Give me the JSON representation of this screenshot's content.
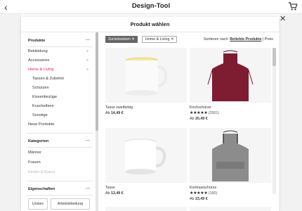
{
  "app": {
    "title": "Design-Tool"
  },
  "modal": {
    "title": "Produkt wählen",
    "close_glyph": "✕"
  },
  "sidebar": {
    "products_heading": "Produkte",
    "products_items": [
      {
        "label": "Bekleidung",
        "chevron": "⌄"
      },
      {
        "label": "Accessoires",
        "chevron": "⌄"
      },
      {
        "label": "Home & Living",
        "chevron": "⌃",
        "active": true
      },
      {
        "label": "Tassen & Zubehör"
      },
      {
        "label": "Schürzen"
      },
      {
        "label": "Kissenbezüge"
      },
      {
        "label": "Kuscheltiere"
      },
      {
        "label": "Sonstige"
      },
      {
        "label": "Neue Produkte"
      }
    ],
    "categories_heading": "Kategorien",
    "categories_items": [
      {
        "label": "Männer"
      },
      {
        "label": "Frauen"
      },
      {
        "label": "Kinder & Babys",
        "disabled": true
      }
    ],
    "properties_heading": "Eigenschaften",
    "toggle_glyph": "—",
    "property_buttons": [
      "Unisex",
      "Arbeitskleidung"
    ]
  },
  "filters": {
    "reset_label": "Zurücksetzen",
    "active_chip": "Home & Living",
    "remove_glyph": "✕",
    "sort_prefix": "Sortieren nach:",
    "sort_value": "Beliebte Produkte",
    "sort_suffix": "| Preis"
  },
  "products": [
    {
      "title": "Tasse zweifarbig",
      "price_prefix": "Ab",
      "price": "14,49 €"
    },
    {
      "title": "Kochschürze",
      "stars": "★★★★★",
      "reviews": "(2501)",
      "price_prefix": "Ab",
      "price": "20,49 €"
    },
    {
      "title": "Tasse",
      "price_prefix": "Ab",
      "price": "13,49 €"
    },
    {
      "title": "Kontrastschürze",
      "stars": "★★★★★",
      "reviews": "(160)",
      "price_prefix": "Ab",
      "price": "23,49 €"
    }
  ],
  "colors": {
    "accent": "#e0284f",
    "apron": "#7e1c31",
    "apron_gray": "#8c8c8c"
  }
}
